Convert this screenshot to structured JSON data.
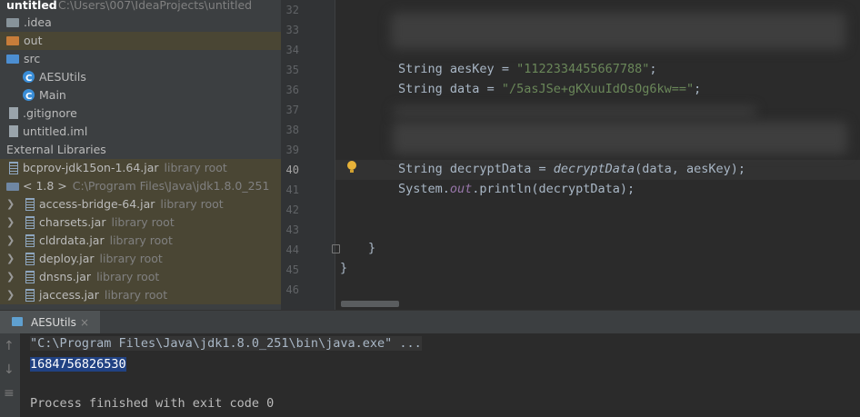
{
  "project_tree": {
    "root": {
      "name": "untitled",
      "path": "C:\\Users\\007\\IdeaProjects\\untitled"
    },
    "items": [
      {
        "label": ".idea",
        "icon": "folder-icon"
      },
      {
        "label": "out",
        "icon": "folder-icon"
      },
      {
        "label": "src",
        "icon": "folder-icon"
      },
      {
        "label": "AESUtils",
        "icon": "class-icon"
      },
      {
        "label": "Main",
        "icon": "class-icon"
      },
      {
        "label": ".gitignore",
        "icon": "file-icon"
      },
      {
        "label": "untitled.iml",
        "icon": "file-icon"
      }
    ],
    "external_libraries_label": "External Libraries",
    "bcprov": {
      "name": "bcprov-jdk15on-1.64.jar",
      "suffix": "library root"
    },
    "jdk": {
      "name": "< 1.8 >",
      "path": "C:\\Program Files\\Java\\jdk1.8.0_251"
    },
    "jars": [
      {
        "name": "access-bridge-64.jar",
        "suffix": "library root"
      },
      {
        "name": "charsets.jar",
        "suffix": "library root"
      },
      {
        "name": "cldrdata.jar",
        "suffix": "library root"
      },
      {
        "name": "deploy.jar",
        "suffix": "library root"
      },
      {
        "name": "dnsns.jar",
        "suffix": "library root"
      },
      {
        "name": "jaccess.jar",
        "suffix": "library root"
      }
    ]
  },
  "editor": {
    "line_numbers": [
      "32",
      "33",
      "34",
      "35",
      "36",
      "37",
      "38",
      "39",
      "40",
      "41",
      "42",
      "43",
      "44",
      "45",
      "46"
    ],
    "code": {
      "l35": {
        "type": "String",
        "var": "aesKey",
        "eq": " = ",
        "val": "\"1122334455667788\"",
        "end": ";"
      },
      "l36": {
        "type": "String",
        "var": "data",
        "eq": " = ",
        "val": "\"/5asJSe+gKXuuIdOsOg6kw==\"",
        "end": ";"
      },
      "l40": {
        "type": "String",
        "var": "decryptData",
        "eq": " = ",
        "call": "decryptData",
        "args": "(data, aesKey);"
      },
      "l41": {
        "prefix": "System.",
        "field": "out",
        "suffix": ".println(decryptData);"
      },
      "l44": "}",
      "l45": "}"
    }
  },
  "run_panel": {
    "tab_label": "AESUtils",
    "close_glyph": "×",
    "command": "\"C:\\Program Files\\Java\\jdk1.8.0_251\\bin\\java.exe\" ...",
    "output": "1684756826530",
    "finish": "Process finished with exit code 0"
  },
  "colors": {
    "string": "#6a8759",
    "text": "#a9b7c6",
    "selection": "#214283",
    "highlight_row": "#4a4634"
  }
}
